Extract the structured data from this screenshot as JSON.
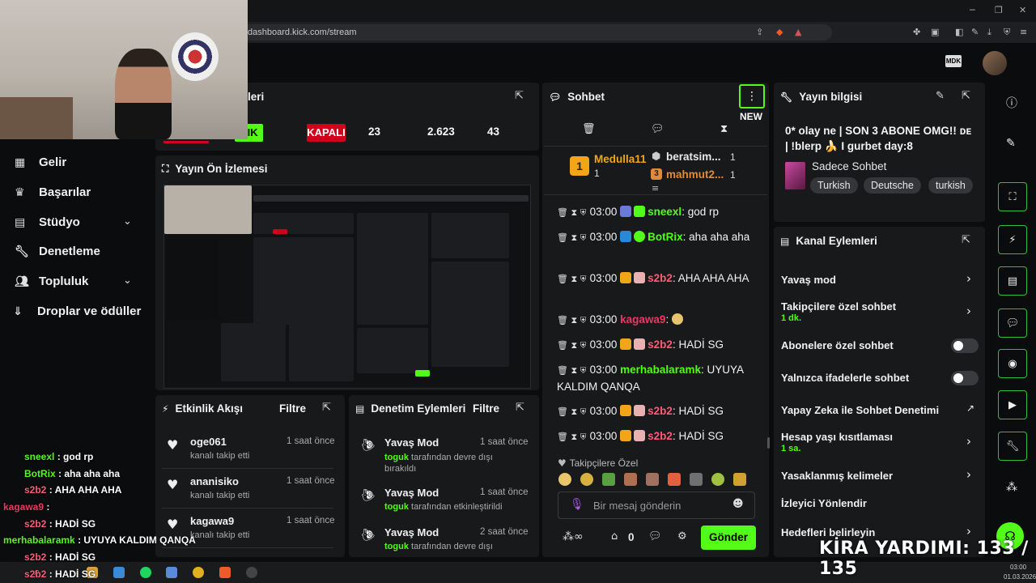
{
  "browser": {
    "url": "dashboard.kick.com/stream"
  },
  "brand_logo": "MDK",
  "nav": [
    {
      "label": "Gelir",
      "icon": "chart-icon"
    },
    {
      "label": "Başarılar",
      "icon": "trophy-icon"
    },
    {
      "label": "Stüdyo",
      "icon": "studio-icon"
    },
    {
      "label": "Denetleme",
      "icon": "wrench-icon"
    },
    {
      "label": "Topluluk",
      "icon": "users-icon"
    },
    {
      "label": "Droplar ve ödüller",
      "icon": "drops-icon"
    }
  ],
  "stats_panel": {
    "title_partial": "leri",
    "stat_green": "CIK",
    "stat_red": "KAPALI",
    "viewers": "23",
    "followers": "2.623",
    "subs": "43"
  },
  "preview_panel": {
    "title": "Yayın Ön İzlemesi"
  },
  "activity": {
    "title": "Etkinlik Akışı",
    "filter": "Filtre",
    "items": [
      {
        "name": "oge061",
        "sub": "kanalı takip etti",
        "time": "1 saat önce"
      },
      {
        "name": "ananisiko",
        "sub": "kanalı takip etti",
        "time": "1 saat önce"
      },
      {
        "name": "kagawa9",
        "sub": "kanalı takip etti",
        "time": "1 saat önce"
      }
    ]
  },
  "moderation": {
    "title": "Denetim Eylemleri",
    "filter": "Filtre",
    "items": [
      {
        "name": "Yavaş Mod",
        "user": "toguk",
        "action": "tarafından devre dışı bırakıldı",
        "time": "1 saat önce"
      },
      {
        "name": "Yavaş Mod",
        "user": "toguk",
        "action": "tarafından etkinleştirildi",
        "time": "1 saat önce"
      },
      {
        "name": "Yavaş Mod",
        "user": "toguk",
        "action": "tarafından devre dışı",
        "time": "2 saat önce"
      }
    ]
  },
  "chat": {
    "title": "Sohbet",
    "new_badge": "NEW",
    "top": [
      {
        "rank": "1",
        "name": "Medulla11",
        "count": "1"
      },
      {
        "name": "beratsim...",
        "count": "1"
      },
      {
        "rank": "3",
        "name": "mahmut2...",
        "count": "1"
      }
    ],
    "messages": [
      {
        "time": "03:00",
        "user": "sneexl",
        "color": "#53fc18",
        "text": "god rp"
      },
      {
        "time": "03:00",
        "user": "BotRix",
        "color": "#53fc18",
        "text": "aha aha aha"
      },
      {
        "time": "03:00",
        "user": "s2b2",
        "color": "#ff5a7a",
        "text": "AHA AHA AHA"
      },
      {
        "time": "03:00",
        "user": "kagawa9",
        "color": "#e63a62",
        "text": ""
      },
      {
        "time": "03:00",
        "user": "s2b2",
        "color": "#ff5a7a",
        "text": "HADİ SG"
      },
      {
        "time": "03:00",
        "user": "merhabalaramk",
        "color": "#53fc18",
        "text": "UYUYA KALDIM QANQA"
      },
      {
        "time": "03:00",
        "user": "s2b2",
        "color": "#ff5a7a",
        "text": "HADİ SG"
      },
      {
        "time": "03:00",
        "user": "s2b2",
        "color": "#ff5a7a",
        "text": "HADİ SG"
      }
    ],
    "followers_only": "Takipçilere Özel",
    "input_placeholder": "Bir mesaj gönderin",
    "points": "0",
    "send": "Gönder"
  },
  "stream_info": {
    "title": "Yayın bilgisi",
    "stream_title": "0* olay ne | SON 3 ABONE OMG!! ᴅᴇ | !blerp 🍌 I gurbet day:8",
    "category": "Sadece Sohbet",
    "tags": [
      "Turkish",
      "Deutsche",
      "turkish"
    ]
  },
  "channel_actions": {
    "title": "Kanal Eylemleri",
    "items": [
      {
        "label": "Yavaş mod",
        "sub": "",
        "control": "chevron"
      },
      {
        "label": "Takipçilere özel sohbet",
        "sub": "1 dk.",
        "control": "chevron"
      },
      {
        "label": "Abonelere özel sohbet",
        "sub": "",
        "control": "toggle"
      },
      {
        "label": "Yalnızca ifadelerle sohbet",
        "sub": "",
        "control": "toggle"
      },
      {
        "label": "Yapay Zeka ile Sohbet Denetimi",
        "sub": "",
        "control": "external"
      },
      {
        "label": "Hesap yaşı kısıtlaması",
        "sub": "1 sa.",
        "control": "chevron"
      },
      {
        "label": "Yasaklanmış kelimeler",
        "sub": "",
        "control": "chevron"
      },
      {
        "label": "İzleyici Yönlendir",
        "sub": "",
        "control": "none"
      },
      {
        "label": "Hedefleri belirleyin",
        "sub": "",
        "control": "chevron"
      }
    ]
  },
  "overlay_chat": [
    {
      "user": "sneexl",
      "color": "#53fc18",
      "text": ": god rp"
    },
    {
      "user": "BotRix",
      "color": "#53fc18",
      "text": ": aha aha aha"
    },
    {
      "user": "s2b2",
      "color": "#ff5a7a",
      "text": ": AHA AHA AHA"
    },
    {
      "user": "kagawa9",
      "color": "#e63a62",
      "text": ":"
    },
    {
      "user": "s2b2",
      "color": "#ff5a7a",
      "text": ": HADİ SG"
    },
    {
      "user": "merhabalaramk",
      "color": "#53fc18",
      "text": ": UYUYA KALDIM QANQA"
    },
    {
      "user": "s2b2",
      "color": "#ff5a7a",
      "text": ": HADİ SG"
    },
    {
      "user": "s2b2",
      "color": "#ff5a7a",
      "text": ": HADİ SG"
    }
  ],
  "kira_overlay": "KİRA YARDIMI:  133 / 135",
  "clock": {
    "time": "03:00",
    "date": "01.03.2026"
  },
  "colors": {
    "accent": "#53fc18",
    "danger": "#d0021b",
    "panel": "#18191b"
  }
}
